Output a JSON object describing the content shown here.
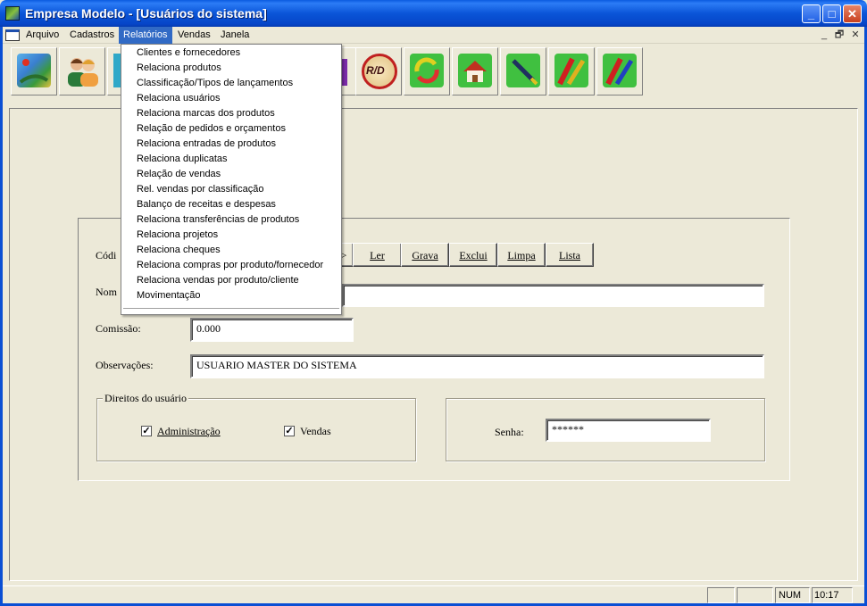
{
  "window": {
    "title": "Empresa Modelo - [Usuários do sistema]",
    "minimize": "_",
    "maximize": "□",
    "close": "✕"
  },
  "menubar": {
    "items": [
      "Arquivo",
      "Cadastros",
      "Relatórios",
      "Vendas",
      "Janela"
    ],
    "active": "Relatórios",
    "mdi_controls": [
      "_",
      "🗗",
      "✕"
    ]
  },
  "toolbar": {
    "icons": [
      "map-icon",
      "users-icon",
      "partial-icon",
      "rd-icon",
      "refresh-icon",
      "home-icon",
      "pen-icon",
      "pencil-red-icon",
      "pencil-blue-icon"
    ],
    "rd_label": "R/D"
  },
  "relatorios_menu": {
    "items": [
      "Clientes e fornecedores",
      "Relaciona produtos",
      "Classificação/Tipos de lançamentos",
      "Relaciona usuários",
      "Relaciona marcas dos produtos",
      "Relação de pedidos e orçamentos",
      "Relaciona entradas de produtos",
      "Relaciona duplicatas",
      "Relação de vendas",
      "Rel. vendas por classificação",
      "Balanço de receitas e despesas",
      "Relaciona transferências de produtos",
      "Relaciona projetos",
      "Relaciona cheques",
      "Relaciona compras por produto/fornecedor",
      "Relaciona vendas por produto/cliente",
      "Movimentação"
    ]
  },
  "form": {
    "codigo_label": "Códi",
    "nome_label": "Nom",
    "nav_partial": ">",
    "buttons": [
      "Ler",
      "Grava",
      "Exclui",
      "Limpa",
      "Lista"
    ],
    "nome_value": "",
    "comissao_label": "Comissão:",
    "comissao_value": "0.000",
    "observacoes_label": "Observações:",
    "observacoes_value": "USUARIO MASTER DO SISTEMA",
    "direitos_title": "Direitos do usuário",
    "admin_label": "Administração",
    "admin_checked": "✓",
    "vendas_label": "Vendas",
    "vendas_checked": "✓",
    "senha_label": "Senha:",
    "senha_value": "******"
  },
  "statusbar": {
    "num": "NUM",
    "time": "10:17"
  }
}
